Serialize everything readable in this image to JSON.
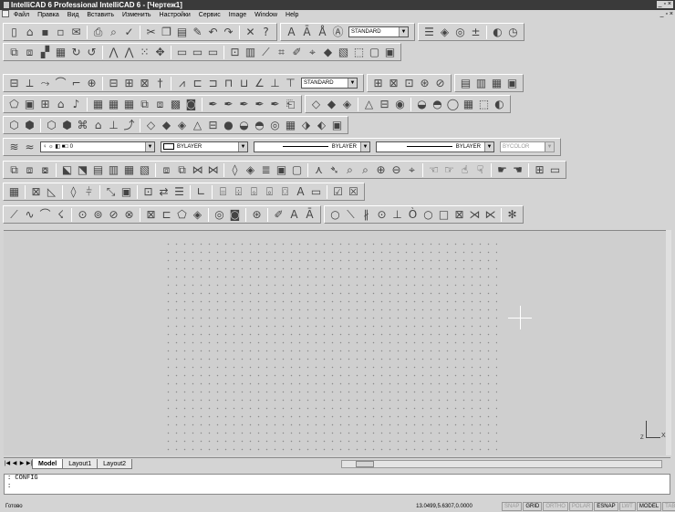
{
  "window": {
    "title": "IntelliCAD 6 Professional IntelliCAD 6 - [Чертеж1]",
    "controls": "_ ▫ ×"
  },
  "menu": [
    "Файл",
    "Правка",
    "Вид",
    "Вставить",
    "Изменить",
    "Настройки",
    "Сервис",
    "Image",
    "Window",
    "Help"
  ],
  "toolbar": {
    "text_style": "STANDARD",
    "dim_style": "STANDARD",
    "layer": "0",
    "color": "BYLAYER",
    "linetype": "BYLAYER",
    "lineweight": "BYLAYER",
    "plotstyle": "BYCOLOR"
  },
  "tabs": [
    "Model",
    "Layout1",
    "Layout2"
  ],
  "active_tab": "Model",
  "command": {
    "history": ":   CONFIG",
    "prompt": ":"
  },
  "status": {
    "ready": "Готово",
    "coords": "13.0499,5.6307,0.0000",
    "buttons": [
      {
        "label": "SNAP",
        "on": false
      },
      {
        "label": "GRID",
        "on": true
      },
      {
        "label": "ORTHO",
        "on": false
      },
      {
        "label": "POLAR",
        "on": false
      },
      {
        "label": "ESNAP",
        "on": true
      },
      {
        "label": "LWT",
        "on": false
      },
      {
        "label": "MODEL",
        "on": true
      },
      {
        "label": "TABLE",
        "on": false
      }
    ]
  },
  "ucs": {
    "x_label": "X",
    "z_label": "Z"
  }
}
